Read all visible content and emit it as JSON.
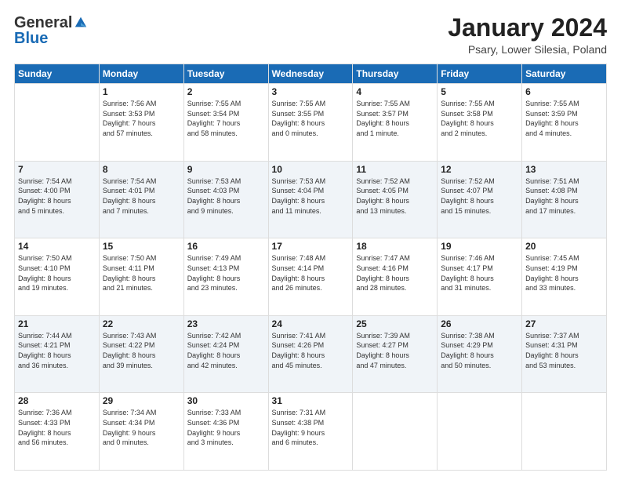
{
  "header": {
    "logo_general": "General",
    "logo_blue": "Blue",
    "month": "January 2024",
    "location": "Psary, Lower Silesia, Poland"
  },
  "days_of_week": [
    "Sunday",
    "Monday",
    "Tuesday",
    "Wednesday",
    "Thursday",
    "Friday",
    "Saturday"
  ],
  "weeks": [
    [
      {
        "num": "",
        "info": ""
      },
      {
        "num": "1",
        "info": "Sunrise: 7:56 AM\nSunset: 3:53 PM\nDaylight: 7 hours\nand 57 minutes."
      },
      {
        "num": "2",
        "info": "Sunrise: 7:55 AM\nSunset: 3:54 PM\nDaylight: 7 hours\nand 58 minutes."
      },
      {
        "num": "3",
        "info": "Sunrise: 7:55 AM\nSunset: 3:55 PM\nDaylight: 8 hours\nand 0 minutes."
      },
      {
        "num": "4",
        "info": "Sunrise: 7:55 AM\nSunset: 3:57 PM\nDaylight: 8 hours\nand 1 minute."
      },
      {
        "num": "5",
        "info": "Sunrise: 7:55 AM\nSunset: 3:58 PM\nDaylight: 8 hours\nand 2 minutes."
      },
      {
        "num": "6",
        "info": "Sunrise: 7:55 AM\nSunset: 3:59 PM\nDaylight: 8 hours\nand 4 minutes."
      }
    ],
    [
      {
        "num": "7",
        "info": "Sunrise: 7:54 AM\nSunset: 4:00 PM\nDaylight: 8 hours\nand 5 minutes."
      },
      {
        "num": "8",
        "info": "Sunrise: 7:54 AM\nSunset: 4:01 PM\nDaylight: 8 hours\nand 7 minutes."
      },
      {
        "num": "9",
        "info": "Sunrise: 7:53 AM\nSunset: 4:03 PM\nDaylight: 8 hours\nand 9 minutes."
      },
      {
        "num": "10",
        "info": "Sunrise: 7:53 AM\nSunset: 4:04 PM\nDaylight: 8 hours\nand 11 minutes."
      },
      {
        "num": "11",
        "info": "Sunrise: 7:52 AM\nSunset: 4:05 PM\nDaylight: 8 hours\nand 13 minutes."
      },
      {
        "num": "12",
        "info": "Sunrise: 7:52 AM\nSunset: 4:07 PM\nDaylight: 8 hours\nand 15 minutes."
      },
      {
        "num": "13",
        "info": "Sunrise: 7:51 AM\nSunset: 4:08 PM\nDaylight: 8 hours\nand 17 minutes."
      }
    ],
    [
      {
        "num": "14",
        "info": "Sunrise: 7:50 AM\nSunset: 4:10 PM\nDaylight: 8 hours\nand 19 minutes."
      },
      {
        "num": "15",
        "info": "Sunrise: 7:50 AM\nSunset: 4:11 PM\nDaylight: 8 hours\nand 21 minutes."
      },
      {
        "num": "16",
        "info": "Sunrise: 7:49 AM\nSunset: 4:13 PM\nDaylight: 8 hours\nand 23 minutes."
      },
      {
        "num": "17",
        "info": "Sunrise: 7:48 AM\nSunset: 4:14 PM\nDaylight: 8 hours\nand 26 minutes."
      },
      {
        "num": "18",
        "info": "Sunrise: 7:47 AM\nSunset: 4:16 PM\nDaylight: 8 hours\nand 28 minutes."
      },
      {
        "num": "19",
        "info": "Sunrise: 7:46 AM\nSunset: 4:17 PM\nDaylight: 8 hours\nand 31 minutes."
      },
      {
        "num": "20",
        "info": "Sunrise: 7:45 AM\nSunset: 4:19 PM\nDaylight: 8 hours\nand 33 minutes."
      }
    ],
    [
      {
        "num": "21",
        "info": "Sunrise: 7:44 AM\nSunset: 4:21 PM\nDaylight: 8 hours\nand 36 minutes."
      },
      {
        "num": "22",
        "info": "Sunrise: 7:43 AM\nSunset: 4:22 PM\nDaylight: 8 hours\nand 39 minutes."
      },
      {
        "num": "23",
        "info": "Sunrise: 7:42 AM\nSunset: 4:24 PM\nDaylight: 8 hours\nand 42 minutes."
      },
      {
        "num": "24",
        "info": "Sunrise: 7:41 AM\nSunset: 4:26 PM\nDaylight: 8 hours\nand 45 minutes."
      },
      {
        "num": "25",
        "info": "Sunrise: 7:39 AM\nSunset: 4:27 PM\nDaylight: 8 hours\nand 47 minutes."
      },
      {
        "num": "26",
        "info": "Sunrise: 7:38 AM\nSunset: 4:29 PM\nDaylight: 8 hours\nand 50 minutes."
      },
      {
        "num": "27",
        "info": "Sunrise: 7:37 AM\nSunset: 4:31 PM\nDaylight: 8 hours\nand 53 minutes."
      }
    ],
    [
      {
        "num": "28",
        "info": "Sunrise: 7:36 AM\nSunset: 4:33 PM\nDaylight: 8 hours\nand 56 minutes."
      },
      {
        "num": "29",
        "info": "Sunrise: 7:34 AM\nSunset: 4:34 PM\nDaylight: 9 hours\nand 0 minutes."
      },
      {
        "num": "30",
        "info": "Sunrise: 7:33 AM\nSunset: 4:36 PM\nDaylight: 9 hours\nand 3 minutes."
      },
      {
        "num": "31",
        "info": "Sunrise: 7:31 AM\nSunset: 4:38 PM\nDaylight: 9 hours\nand 6 minutes."
      },
      {
        "num": "",
        "info": ""
      },
      {
        "num": "",
        "info": ""
      },
      {
        "num": "",
        "info": ""
      }
    ]
  ]
}
